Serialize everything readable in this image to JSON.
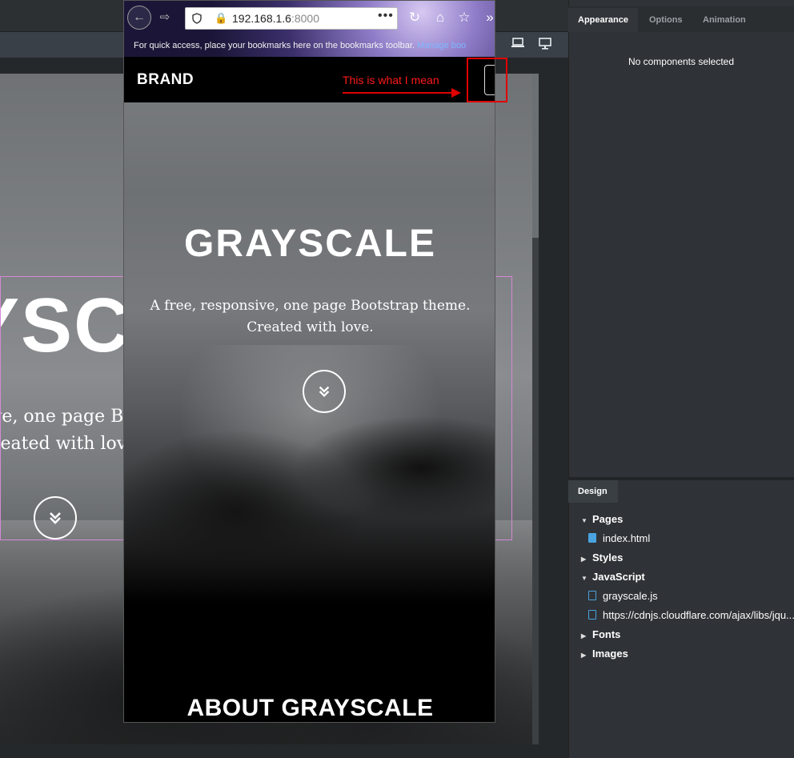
{
  "editor": {
    "device_icons": [
      "laptop-icon",
      "desktop-icon"
    ],
    "background_preview": {
      "title_fragment": "YSC",
      "desc_line1": "ve, one page Bo",
      "desc_line2": "reated with love",
      "down_icon": "double-chevron-down-icon"
    }
  },
  "right_panel": {
    "tabs": [
      {
        "label": "Appearance",
        "active": true
      },
      {
        "label": "Options",
        "active": false
      },
      {
        "label": "Animation",
        "active": false
      }
    ],
    "empty_message": "No components selected",
    "design_tab": "Design",
    "tree": [
      {
        "label": "Pages",
        "type": "folder",
        "expanded": true
      },
      {
        "label": "index.html",
        "type": "page"
      },
      {
        "label": "Styles",
        "type": "folder",
        "expanded": false
      },
      {
        "label": "JavaScript",
        "type": "folder",
        "expanded": true
      },
      {
        "label": "grayscale.js",
        "type": "file"
      },
      {
        "label": "https://cdnjs.cloudflare.com/ajax/libs/jqu...",
        "type": "file"
      },
      {
        "label": "Fonts",
        "type": "folder",
        "expanded": false
      },
      {
        "label": "Images",
        "type": "folder",
        "expanded": false
      }
    ]
  },
  "browser": {
    "url_host": "192.168.1.6",
    "url_port": ":8000",
    "bookmarks_text": "For quick access, place your bookmarks here on the bookmarks toolbar.",
    "bookmarks_link": "Manage boo"
  },
  "site": {
    "brand": "BRAND",
    "menu_icon": "vertical-dots-icon",
    "hero_title": "GRAYSCALE",
    "hero_line1": "A free, responsive, one page Bootstrap theme.",
    "hero_line2": "Created with love.",
    "down_icon": "double-chevron-down-icon",
    "about_title": "ABOUT GRAYSCALE"
  },
  "annotation": {
    "text": "This is what I mean",
    "color": "#ff1a1a"
  },
  "colors": {
    "panel_bg": "#2f3236",
    "selection_outline": "#d488d6",
    "file_icon": "#4aa3df"
  }
}
